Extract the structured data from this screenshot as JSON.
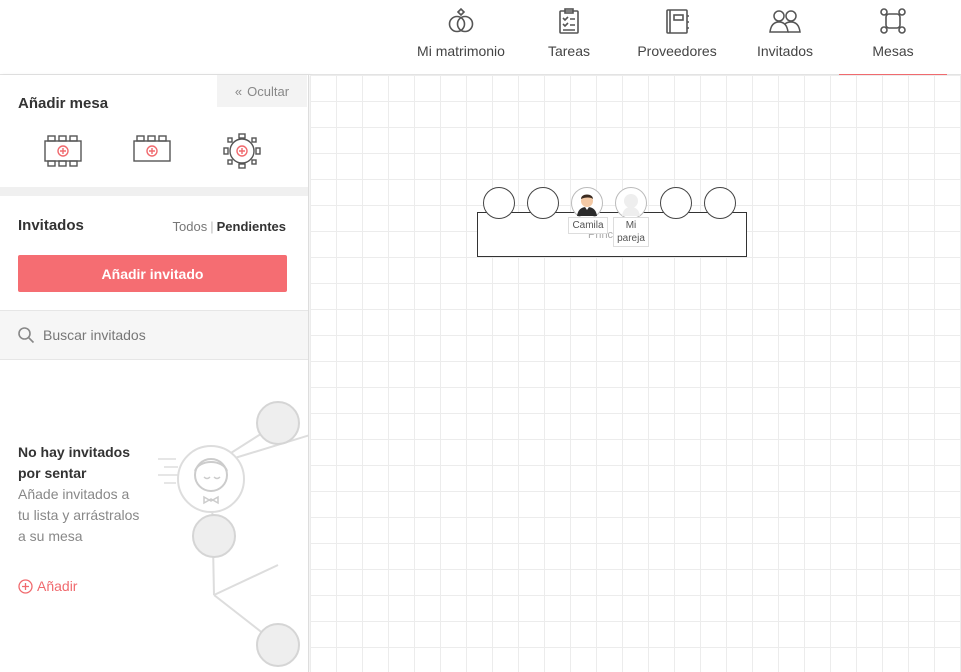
{
  "nav": {
    "items": [
      {
        "label": "Mi matrimonio",
        "icon": "rings-icon"
      },
      {
        "label": "Tareas",
        "icon": "clipboard-icon"
      },
      {
        "label": "Proveedores",
        "icon": "notebook-icon"
      },
      {
        "label": "Invitados",
        "icon": "guests-icon"
      },
      {
        "label": "Mesas",
        "icon": "table-icon"
      }
    ],
    "active": "Mesas",
    "accent_color": "#f06a6e"
  },
  "sidebar": {
    "hide_label": "Ocultar",
    "add_table_title": "Añadir mesa",
    "table_types": [
      "rectangular-long-table-icon",
      "rectangular-table-icon",
      "round-table-icon"
    ],
    "guests_title": "Invitados",
    "filter": {
      "all": "Todos",
      "separator": "|",
      "pending": "Pendientes"
    },
    "add_guest_button": "Añadir invitado",
    "search_placeholder": "Buscar invitados",
    "empty_state": {
      "title": "No hay invitados por sentar",
      "text": "Añade invitados a tu lista y arrástralos a su mesa",
      "add_link": "Añadir"
    }
  },
  "canvas": {
    "table": {
      "name": "Princ",
      "seats": [
        {
          "occupant": ""
        },
        {
          "occupant": ""
        },
        {
          "occupant": "Camila"
        },
        {
          "occupant": "Mi pareja"
        },
        {
          "occupant": ""
        },
        {
          "occupant": ""
        }
      ]
    }
  }
}
